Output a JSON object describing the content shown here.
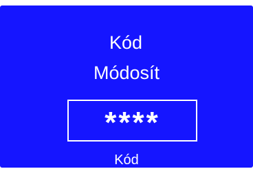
{
  "screen": {
    "title_line_1": "Kód",
    "title_line_2": "Módosít",
    "code_value": "****",
    "footer_label": "Kód",
    "background_color": "#1515ff",
    "text_color": "#ffffff"
  }
}
